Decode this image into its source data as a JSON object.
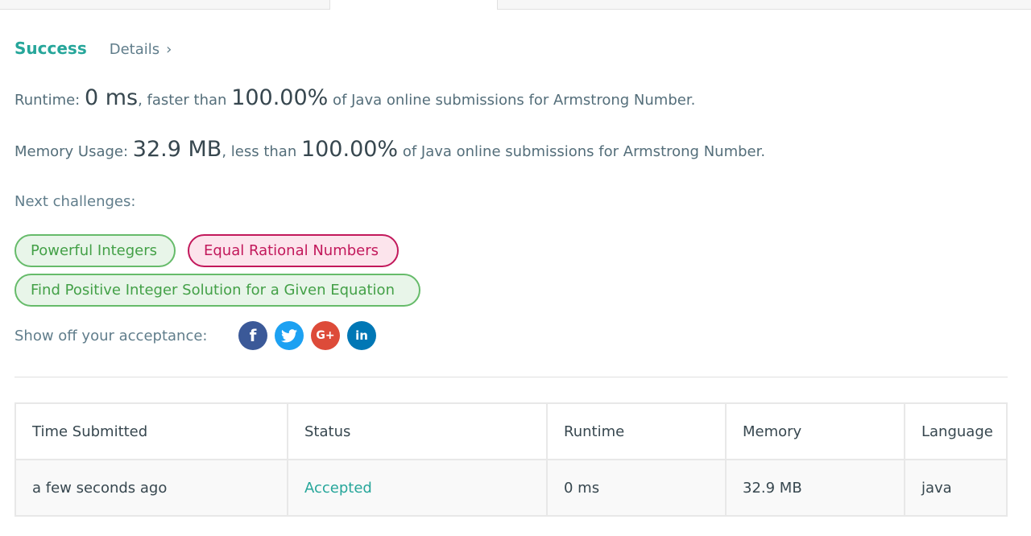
{
  "result": {
    "status": "Success",
    "details_label": "Details",
    "details_chevron": "›"
  },
  "runtime": {
    "label": "Runtime: ",
    "value": "0 ms",
    "comparison": ", faster than ",
    "percent": "100.00%",
    "suffix": " of Java online submissions for Armstrong Number."
  },
  "memory": {
    "label": "Memory Usage: ",
    "value": "32.9 MB",
    "comparison": ", less than ",
    "percent": "100.00%",
    "suffix": " of Java online submissions for Armstrong Number."
  },
  "next_challenges": {
    "label": "Next challenges:",
    "items": [
      {
        "label": "Powerful Integers",
        "difficulty_color": "#43a047"
      },
      {
        "label": "Equal Rational Numbers",
        "difficulty_color": "#c2185b"
      },
      {
        "label": "Find Positive Integer Solution for a Given Equation",
        "difficulty_color": "#43a047"
      }
    ]
  },
  "share": {
    "label": "Show off your acceptance:",
    "icons": [
      {
        "name": "facebook-icon",
        "glyph": "f",
        "color": "#3b5998"
      },
      {
        "name": "twitter-icon",
        "glyph": "",
        "color": "#1da1f2"
      },
      {
        "name": "google-plus-icon",
        "glyph": "G+",
        "color": "#dd4b39"
      },
      {
        "name": "linkedin-icon",
        "glyph": "in",
        "color": "#0077b5"
      }
    ]
  },
  "submissions": {
    "headers": [
      "Time Submitted",
      "Status",
      "Runtime",
      "Memory",
      "Language"
    ],
    "rows": [
      {
        "time": "a few seconds ago",
        "status": "Accepted",
        "runtime": "0 ms",
        "memory": "32.9 MB",
        "language": "java"
      }
    ]
  },
  "colors": {
    "accent": "#26a69a",
    "easy": "#43a047",
    "hard": "#c2185b"
  }
}
